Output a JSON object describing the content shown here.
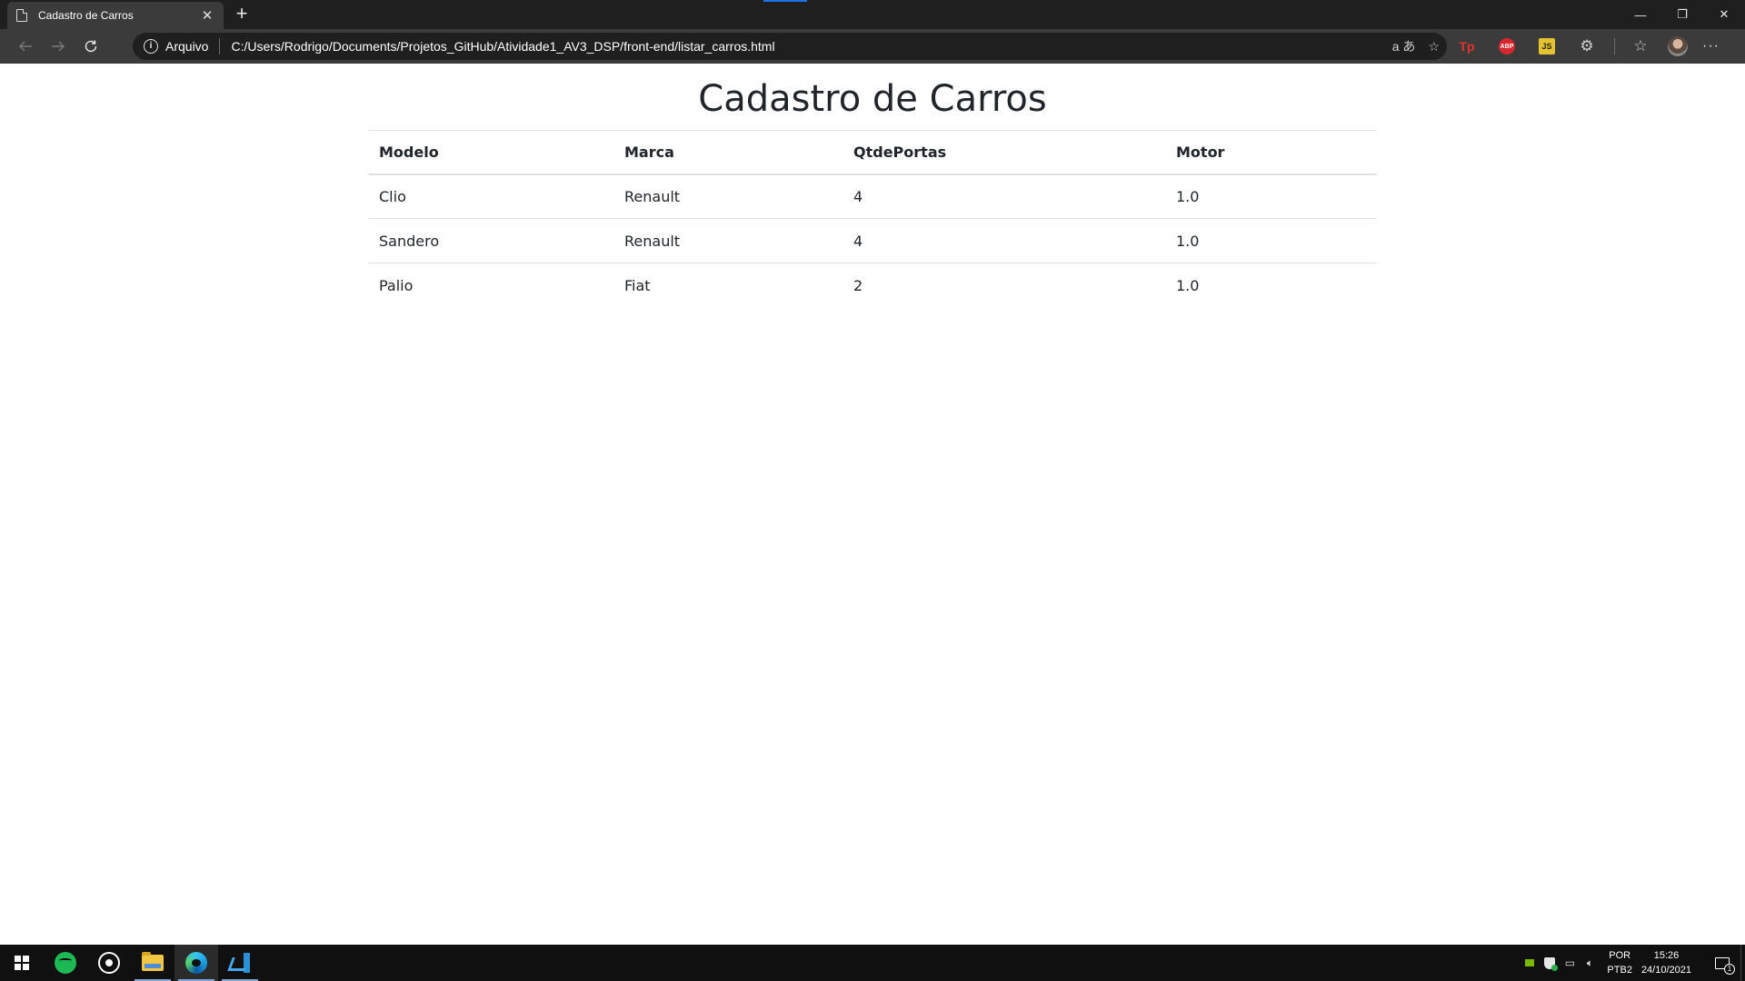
{
  "browser": {
    "tab_title": "Cadastro de Carros",
    "tab_close": "✕",
    "new_tab": "+",
    "address": {
      "site_label": "Arquivo",
      "url": "C:/Users/Rodrigo/Documents/Projetos_GitHub/Atividade1_AV3_DSP/front-end/listar_carros.html"
    },
    "window_controls": {
      "minimize": "—",
      "restore": "❐",
      "close": "✕"
    },
    "extensions": [
      {
        "name": "tp-extension",
        "label": "Tp"
      },
      {
        "name": "adblock-plus",
        "label": "ABP"
      },
      {
        "name": "js-extension",
        "label": "JS"
      }
    ],
    "more_label": "···"
  },
  "page": {
    "title": "Cadastro de Carros",
    "table": {
      "headers": [
        "Modelo",
        "Marca",
        "QtdePortas",
        "Motor"
      ],
      "rows": [
        [
          "Clio",
          "Renault",
          "4",
          "1.0"
        ],
        [
          "Sandero",
          "Renault",
          "4",
          "1.0"
        ],
        [
          "Palio",
          "Fiat",
          "2",
          "1.0"
        ]
      ]
    }
  },
  "taskbar": {
    "apps": [
      {
        "name": "spotify",
        "icon": "spotify-icon",
        "running": false
      },
      {
        "name": "whatsapp",
        "icon": "whatsapp-icon",
        "running": false
      },
      {
        "name": "file-explorer",
        "icon": "folder-icon",
        "running": true
      },
      {
        "name": "edge",
        "icon": "edge-icon",
        "running": true,
        "active": true
      },
      {
        "name": "vscode",
        "icon": "vscode-icon",
        "running": true
      }
    ],
    "tray": {
      "lang_line1": "POR",
      "lang_line2": "PTB2",
      "time": "15:26",
      "date": "24/10/2021",
      "notification_count": "1"
    }
  },
  "colors": {
    "chrome_dark": "#1f1f1f",
    "toolbar": "#3b3b3b",
    "text": "#212529",
    "table_border": "#dee2e6",
    "taskbar": "#101010"
  }
}
